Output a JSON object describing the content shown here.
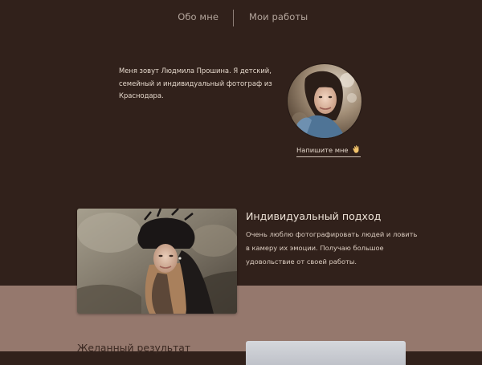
{
  "nav": {
    "items": [
      {
        "label": "Обо мне"
      },
      {
        "label": "Мои работы"
      }
    ]
  },
  "intro": {
    "text": "Меня зовут Людмила Прошина. Я детский, семейный и индивидуальный фотограф из Краснодара.",
    "contact_label": "Напишите мне",
    "contact_icon": "waving-hand-icon"
  },
  "feature": {
    "title": "Индивидуальный подход",
    "text": "Очень люблю фотографировать людей и ловить в камеру их эмоции. Получаю большое удовольствие от своей работы."
  },
  "result": {
    "title": "Желанный результат"
  },
  "colors": {
    "background": "#31211b",
    "band": "#95786d",
    "text_light": "#e4d7cb",
    "nav_text": "#b3a59c"
  }
}
